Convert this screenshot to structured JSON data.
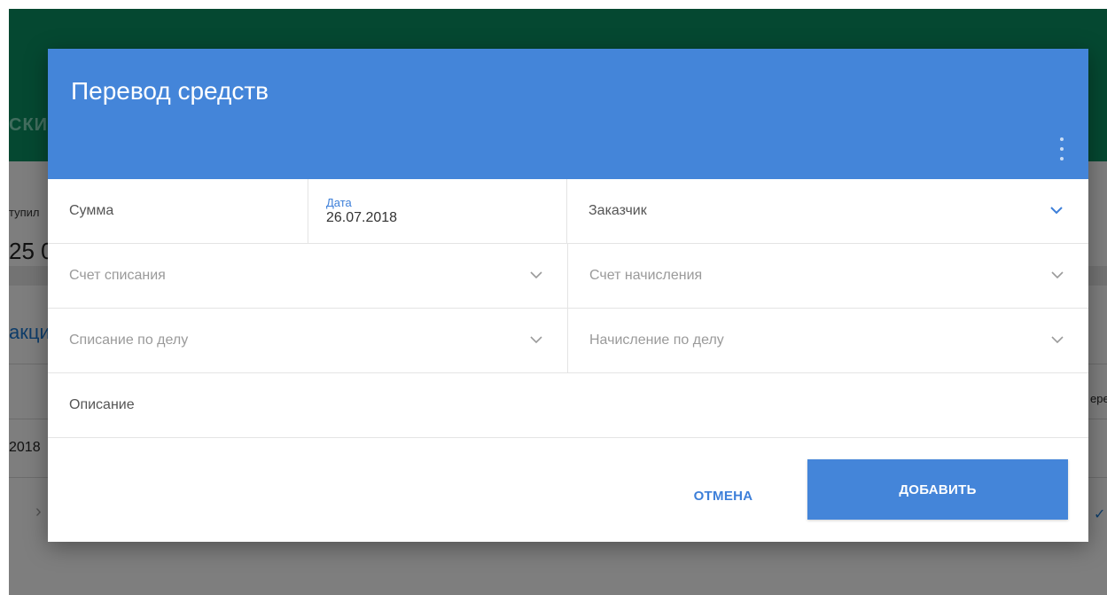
{
  "background": {
    "tab_label": "СКИ",
    "stat_label": "тупил",
    "stat_value": "25 0",
    "section_title": "акци",
    "row_date": "2018",
    "right_text": "ере"
  },
  "dialog": {
    "title": "Перевод средств",
    "fields": {
      "sum": {
        "label": "Сумма"
      },
      "date": {
        "caption": "Дата",
        "value": "26.07.2018"
      },
      "customer": {
        "label": "Заказчик"
      },
      "debit_account": {
        "placeholder": "Счет списания"
      },
      "credit_account": {
        "placeholder": "Счет начисления"
      },
      "debit_case": {
        "placeholder": "Списание по делу"
      },
      "credit_case": {
        "placeholder": "Начисление по делу"
      },
      "description": {
        "label": "Описание"
      }
    },
    "actions": {
      "cancel_label": "ОТМЕНА",
      "add_label": "ДОБАВИТЬ"
    }
  },
  "colors": {
    "header": "#4485d9",
    "accent": "#3d7fd9",
    "topbar": "#0a8a5f"
  },
  "icons": {
    "menu": "more-vertical-icon",
    "dropdown": "chevron-down-icon"
  }
}
